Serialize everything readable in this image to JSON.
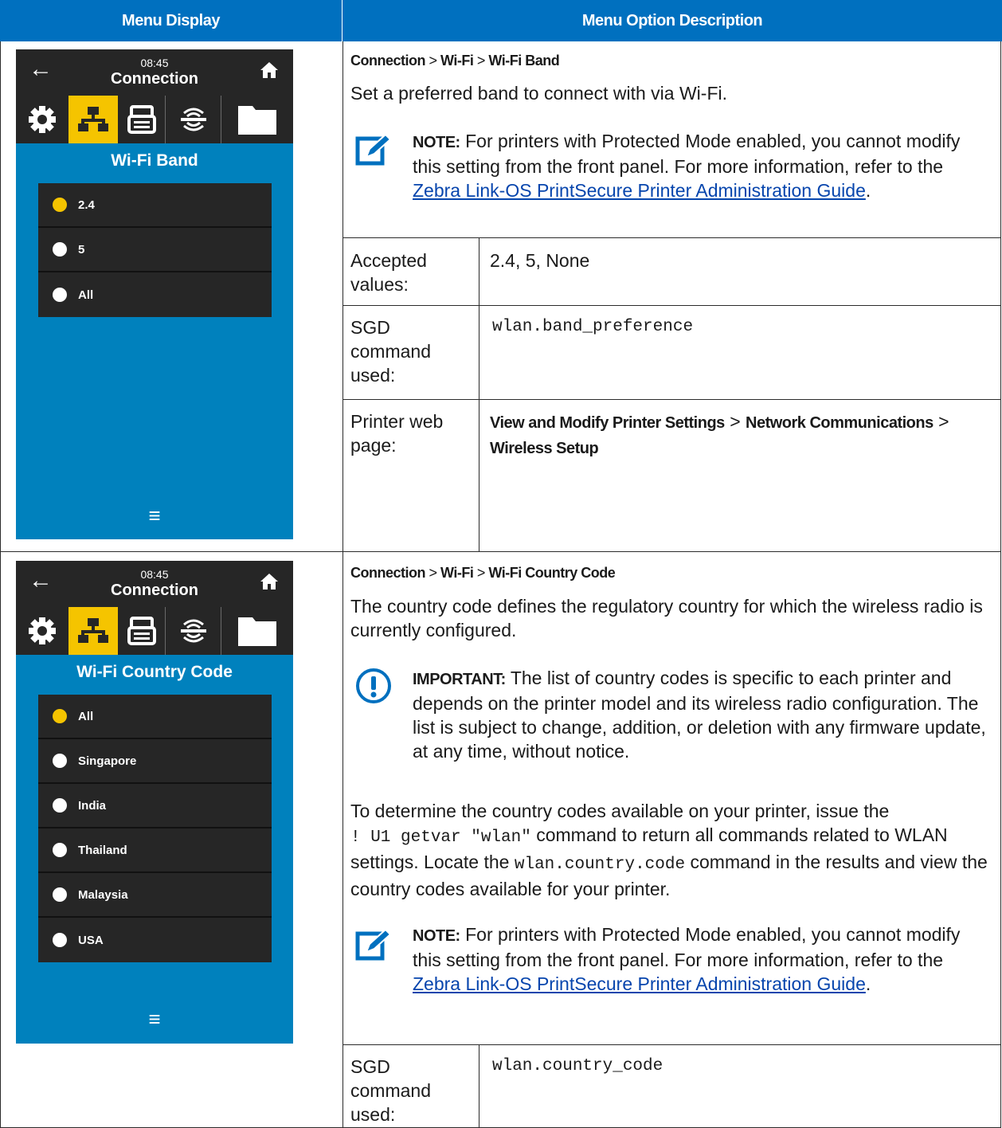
{
  "headers": {
    "menu_display": "Menu Display",
    "menu_option_description": "Menu Option Description"
  },
  "screen1": {
    "time": "08:45",
    "title": "Connection",
    "subtitle": "Wi-Fi Band",
    "options": [
      {
        "label": "2.4",
        "selected": true
      },
      {
        "label": "5",
        "selected": false
      },
      {
        "label": "All",
        "selected": false
      }
    ]
  },
  "screen2": {
    "time": "08:45",
    "title": "Connection",
    "subtitle": "Wi-Fi Country Code",
    "options": [
      {
        "label": "All",
        "selected": true
      },
      {
        "label": "Singapore",
        "selected": false
      },
      {
        "label": "India",
        "selected": false
      },
      {
        "label": "Thailand",
        "selected": false
      },
      {
        "label": "Malaysia",
        "selected": false
      },
      {
        "label": "USA",
        "selected": false
      }
    ]
  },
  "row1": {
    "path": [
      "Connection",
      "Wi-Fi",
      "Wi-Fi Band"
    ],
    "path_sep": ">",
    "desc": "Set a preferred band to connect with via Wi-Fi.",
    "note_label": "NOTE:",
    "note_text": " For printers with Protected Mode enabled, you cannot modify this setting from the front panel. For more information, refer to the ",
    "note_link": "Zebra Link-OS PrintSecure Printer Administration Guide",
    "note_end": ".",
    "accepted_label": "Accepted values:",
    "accepted_value": "2.4, 5, None",
    "sgd_label": "SGD command used:",
    "sgd_value": "wlan.band_preference",
    "web_label": "Printer web page:",
    "web_parts": [
      "View and Modify Printer Settings",
      "Network Communications",
      "Wireless Setup"
    ]
  },
  "row2": {
    "path": [
      "Connection",
      "Wi-Fi",
      "Wi-Fi Country Code"
    ],
    "desc": "The country code defines the regulatory country for which the wireless radio is currently configured.",
    "important_label": "IMPORTANT:",
    "important_text": " The list of country codes is specific to each printer and depends on the printer model and its wireless radio configuration. The list is subject to change, addition, or deletion with any firmware update, at any time, without notice.",
    "para_a": "To determine the country codes available on your printer, issue the",
    "code_a": "! U1 getvar \"wlan\"",
    "para_b": " command to return all commands related to WLAN settings. Locate the ",
    "code_b": "wlan.country.code",
    "para_c": " command in the results and view the country codes available for your printer.",
    "note_label": "NOTE:",
    "note_text": " For printers with Protected Mode enabled, you cannot modify this setting from the front panel. For more information, refer to the ",
    "note_link": "Zebra Link-OS PrintSecure Printer Administration Guide",
    "note_end": ".",
    "sgd_label": "SGD command used:",
    "sgd_value": "wlan.country_code"
  },
  "icons": [
    "back-arrow-icon",
    "home-icon",
    "gear-icon",
    "network-icon",
    "printer-icon",
    "wireless-icon",
    "folder-icon",
    "menu-icon",
    "note-icon",
    "important-icon"
  ],
  "colors": {
    "header_blue": "#0070bf",
    "screen_blue": "#0081bd",
    "dark": "#262626",
    "selected_yellow": "#f5c400",
    "link": "#0645ad"
  }
}
